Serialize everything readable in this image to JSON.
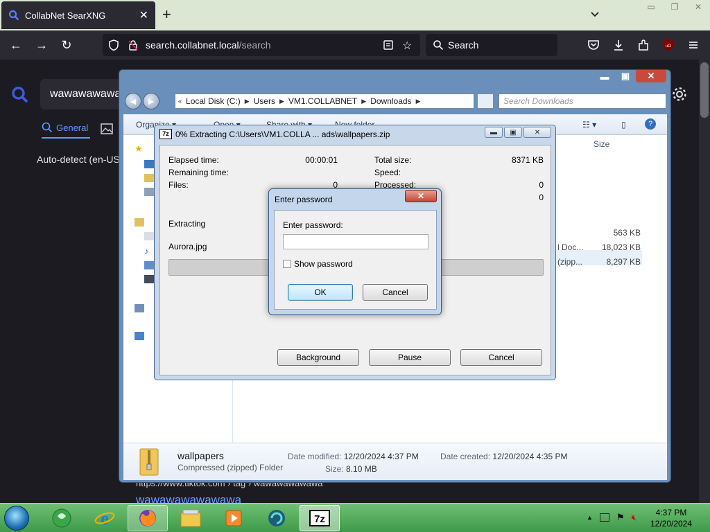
{
  "browser": {
    "tab_title": "CollabNet SearXNG",
    "url_host": "search.collabnet.local",
    "url_path": "/search",
    "search_placeholder": "Search"
  },
  "page": {
    "query": "wawawawawawa",
    "tab_general": "General",
    "language": "Auto-detect (en-US)",
    "result_url": "https://www.tiktok.com › tag › wawawawawawa",
    "result_title": "wawawawawawawa"
  },
  "explorer": {
    "breadcrumb": [
      "Local Disk (C:)",
      "Users",
      "VM1.COLLABNET",
      "Downloads"
    ],
    "search_placeholder": "Search Downloads",
    "toolbar": [
      "Organize ▾",
      "Open ▾",
      "Share with ▾",
      "New folder"
    ],
    "column_size": "Size",
    "rows": [
      {
        "type": "",
        "size": "563 KB"
      },
      {
        "type": "l Doc...",
        "size": "18,023 KB"
      },
      {
        "type": "(zipp...",
        "size": "8,297 KB"
      }
    ],
    "details": {
      "name": "wallpapers",
      "type": "Compressed (zipped) Folder",
      "modified_label": "Date modified:",
      "modified": "12/20/2024 4:37 PM",
      "created_label": "Date created:",
      "created": "12/20/2024 4:35 PM",
      "size_label": "Size:",
      "size": "8.10 MB"
    }
  },
  "sevenzip": {
    "title": "0% Extracting C:\\Users\\VM1.COLLA ... ads\\wallpapers.zip",
    "elapsed_label": "Elapsed time:",
    "elapsed": "00:00:01",
    "remaining_label": "Remaining time:",
    "files_label": "Files:",
    "files": "0",
    "total_size_label": "Total size:",
    "total_size": "8371 KB",
    "speed_label": "Speed:",
    "processed_label": "Processed:",
    "processed": "0",
    "compressed": "0",
    "progress": 0,
    "action": "Extracting",
    "current_file": "Aurora.jpg",
    "btn_background": "Background",
    "btn_pause": "Pause",
    "btn_cancel": "Cancel"
  },
  "password_dialog": {
    "title": "Enter password",
    "label": "Enter password:",
    "value": "",
    "show_password": "Show password",
    "ok": "OK",
    "cancel": "Cancel"
  },
  "taskbar": {
    "time": "4:37 PM",
    "date": "12/20/2024",
    "items": [
      "start",
      "media-center",
      "internet-explorer",
      "firefox",
      "file-explorer",
      "media-player",
      "app-spiral",
      "7zip"
    ]
  },
  "colors": {
    "firefox_dark": "#2b2a33",
    "link_blue": "#5f9cff",
    "taskbar_green": "#3e9a4a",
    "window_blue": "#6a8fba"
  }
}
